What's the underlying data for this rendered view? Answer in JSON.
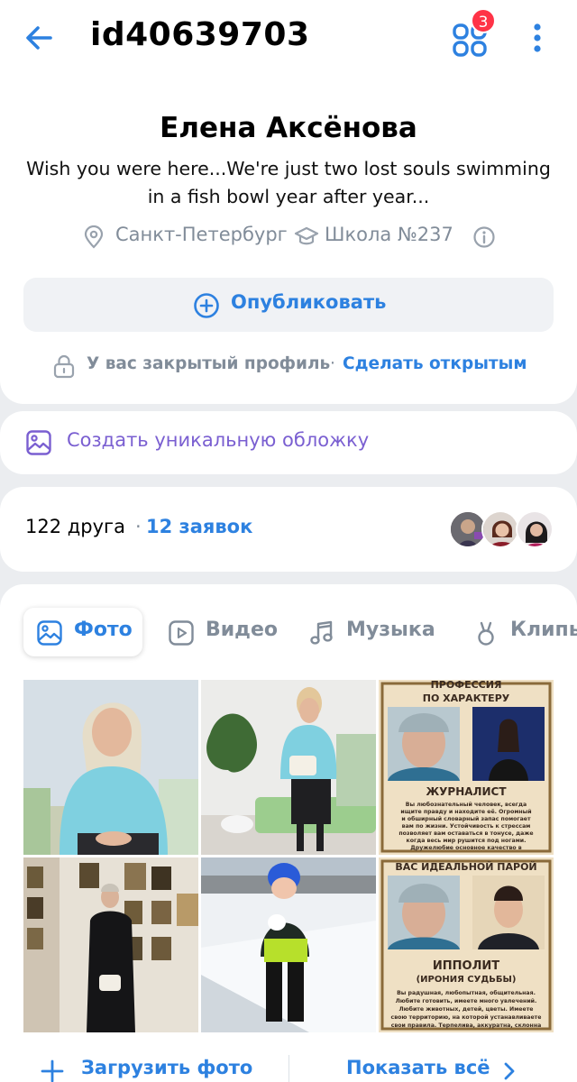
{
  "header": {
    "page_id": "id40639703",
    "apps_badge": "3"
  },
  "profile": {
    "name": "Елена Аксёнова",
    "status": "Wish you were here...We're just two lost souls swimming in a fish bowl year after year...",
    "city": "Санкт-Петербург",
    "school": "Школа №237"
  },
  "publish": {
    "label": "Опубликовать"
  },
  "privacy": {
    "text": "У вас закрытый профиль",
    "separator": "·",
    "link": "Сделать открытым"
  },
  "cover": {
    "label": "Создать уникальную обложку"
  },
  "friends": {
    "count": "122 друга",
    "separator": "·",
    "requests": "12 заявок"
  },
  "tabs": [
    {
      "label": "Фото",
      "icon": "photo-icon",
      "active": true
    },
    {
      "label": "Видео",
      "icon": "video-icon",
      "active": false
    },
    {
      "label": "Музыка",
      "icon": "music-icon",
      "active": false
    },
    {
      "label": "Клипы",
      "icon": "clips-icon",
      "active": false
    }
  ],
  "photos": {
    "p3": {
      "title": "ПРОФЕССИЯ",
      "subtitle": "ПО ХАРАКТЕРУ",
      "role": "ЖУРНАЛИСТ",
      "lines": [
        "Вы любознательный человек, всегда",
        "ищите правду и находите её. Огромный",
        "и обширный словарный запас помогает",
        "вам по жизни. Устойчивость к стрессам",
        "позволяет вам оставаться в тонусе, даже",
        "когда весь мир рушится под ногами.",
        "Дружелюбие основное качество в"
      ]
    },
    "p6": {
      "title": "ВАС ИДЕАЛЬНОЙ ПАРОЙ",
      "role": "ИППОЛИТ",
      "subtitle": "(ИРОНИЯ СУДЬБЫ)",
      "lines": [
        "Вы радушная, любопытная, общительная.",
        "Любите готовить, имеете много увлечений.",
        "Любите животных, детей, цветы. Имеете",
        "свою территорию, на которой устанавливаете",
        "свои правила. Терпелива, аккуратна, склонна"
      ]
    }
  },
  "actions": {
    "upload": "Загрузить фото",
    "show_all": "Показать всё"
  },
  "colors": {
    "accent": "#2d81e0",
    "secondary": "#818c99",
    "cover_accent": "#7a5fd1",
    "badge": "#ff3347",
    "background": "#ebedf0"
  }
}
